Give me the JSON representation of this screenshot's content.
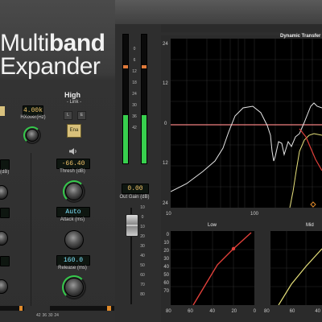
{
  "plugin": {
    "title_part1": "Multi",
    "title_part2": "band",
    "title_line2": "Expander"
  },
  "low_band": {
    "xover_value": "4.00k",
    "xover_label": "HXover(Hz)",
    "thresh_label": "(dB)"
  },
  "high_band": {
    "name": "High",
    "link_label": "- Link -",
    "link_l": "L",
    "link_r": "E",
    "enable_label": "Ena",
    "thresh_value": "-66.40",
    "thresh_label": "Thresh (dB)",
    "attack_value": "Auto",
    "attack_label": "Attack (ms)",
    "release_value": "160.0",
    "release_label": "Release (ms)"
  },
  "output": {
    "gain_value": "0.00",
    "gain_label": "Out Gain (dB)",
    "fader_scale": [
      "10",
      "0",
      "10",
      "20",
      "30",
      "40",
      "50",
      "60",
      "70",
      "80"
    ],
    "meter_scale": [
      "0",
      "6",
      "12",
      "18",
      "24",
      "30",
      "36",
      "42"
    ],
    "meter_bottom_scale": [
      "42",
      "36",
      "30",
      "24"
    ]
  },
  "dynamic_graph": {
    "title": "Dynamic Transfer",
    "y_labels": [
      "24",
      "12",
      "0",
      "12",
      "24"
    ],
    "x_labels": [
      "10",
      "100"
    ],
    "colors": {
      "white": "#e6e6e6",
      "red": "#e0403a",
      "yellow": "#e6e07a",
      "zero_line": "#f08080"
    }
  },
  "low_transfer": {
    "title": "Low",
    "y_labels": [
      "0",
      "10",
      "20",
      "30",
      "40",
      "50",
      "60",
      "70"
    ],
    "x_labels": [
      "80",
      "60",
      "40",
      "20",
      "0"
    ],
    "color": "#e0403a"
  },
  "mid_transfer": {
    "title": "Mid",
    "x_labels": [
      "80",
      "60",
      "40"
    ],
    "color": "#e6e07a"
  },
  "icons": [
    "speaker-icon"
  ]
}
